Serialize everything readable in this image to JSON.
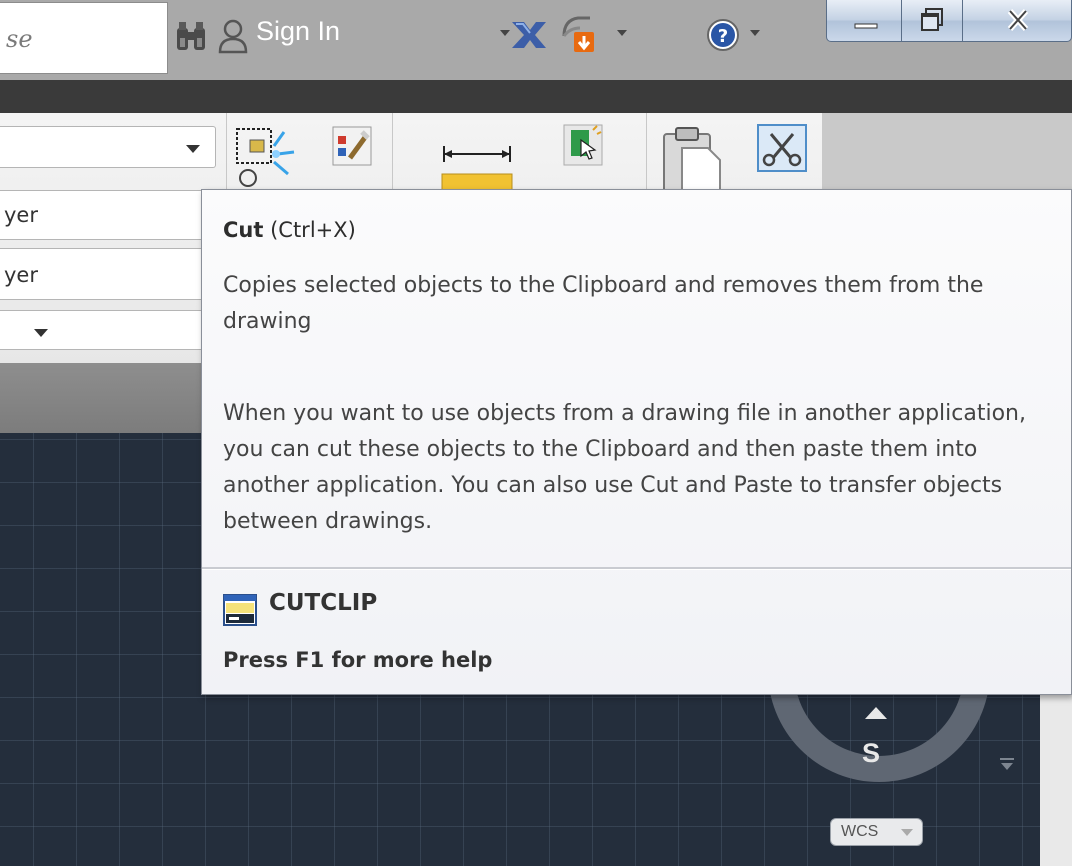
{
  "titlebar": {
    "search_text": "se",
    "signin_label": "Sign In"
  },
  "ribbon": {
    "dropdown_layer_1": "yer",
    "dropdown_layer_2": "yer"
  },
  "viewcube": {
    "compass_label": "S",
    "wcs_label": "WCS"
  },
  "tooltip": {
    "title": "Cut",
    "shortcut": "(Ctrl+X)",
    "description": "Copies selected objects to the Clipboard and removes them from the drawing",
    "details": "When you want to use objects from a drawing file in another application, you can cut these objects to the Clipboard and then paste them into another application. You can also use Cut and Paste to transfer objects between drawings.",
    "command": "CUTCLIP",
    "help": "Press F1 for more help"
  },
  "colors": {
    "tooltip_bg": "#f4f5f8",
    "drawing_bg": "#242e3c",
    "titlebar_bg": "#a9a9a9"
  }
}
